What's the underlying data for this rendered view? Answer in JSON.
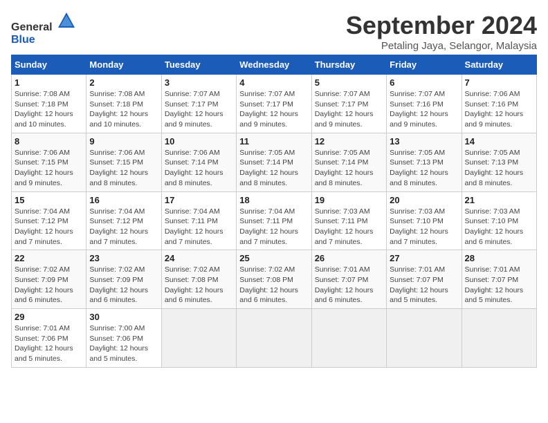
{
  "header": {
    "logo_general": "General",
    "logo_blue": "Blue",
    "month": "September 2024",
    "location": "Petaling Jaya, Selangor, Malaysia"
  },
  "calendar": {
    "weekdays": [
      "Sunday",
      "Monday",
      "Tuesday",
      "Wednesday",
      "Thursday",
      "Friday",
      "Saturday"
    ],
    "weeks": [
      [
        null,
        null,
        {
          "day": "1",
          "sunrise": "Sunrise: 7:08 AM",
          "sunset": "Sunset: 7:18 PM",
          "daylight": "Daylight: 12 hours and 10 minutes."
        },
        {
          "day": "2",
          "sunrise": "Sunrise: 7:08 AM",
          "sunset": "Sunset: 7:18 PM",
          "daylight": "Daylight: 12 hours and 10 minutes."
        },
        {
          "day": "3",
          "sunrise": "Sunrise: 7:07 AM",
          "sunset": "Sunset: 7:17 PM",
          "daylight": "Daylight: 12 hours and 9 minutes."
        },
        {
          "day": "4",
          "sunrise": "Sunrise: 7:07 AM",
          "sunset": "Sunset: 7:17 PM",
          "daylight": "Daylight: 12 hours and 9 minutes."
        },
        {
          "day": "5",
          "sunrise": "Sunrise: 7:07 AM",
          "sunset": "Sunset: 7:17 PM",
          "daylight": "Daylight: 12 hours and 9 minutes."
        },
        {
          "day": "6",
          "sunrise": "Sunrise: 7:07 AM",
          "sunset": "Sunset: 7:16 PM",
          "daylight": "Daylight: 12 hours and 9 minutes."
        },
        {
          "day": "7",
          "sunrise": "Sunrise: 7:06 AM",
          "sunset": "Sunset: 7:16 PM",
          "daylight": "Daylight: 12 hours and 9 minutes."
        }
      ],
      [
        {
          "day": "8",
          "sunrise": "Sunrise: 7:06 AM",
          "sunset": "Sunset: 7:15 PM",
          "daylight": "Daylight: 12 hours and 9 minutes."
        },
        {
          "day": "9",
          "sunrise": "Sunrise: 7:06 AM",
          "sunset": "Sunset: 7:15 PM",
          "daylight": "Daylight: 12 hours and 8 minutes."
        },
        {
          "day": "10",
          "sunrise": "Sunrise: 7:06 AM",
          "sunset": "Sunset: 7:14 PM",
          "daylight": "Daylight: 12 hours and 8 minutes."
        },
        {
          "day": "11",
          "sunrise": "Sunrise: 7:05 AM",
          "sunset": "Sunset: 7:14 PM",
          "daylight": "Daylight: 12 hours and 8 minutes."
        },
        {
          "day": "12",
          "sunrise": "Sunrise: 7:05 AM",
          "sunset": "Sunset: 7:14 PM",
          "daylight": "Daylight: 12 hours and 8 minutes."
        },
        {
          "day": "13",
          "sunrise": "Sunrise: 7:05 AM",
          "sunset": "Sunset: 7:13 PM",
          "daylight": "Daylight: 12 hours and 8 minutes."
        },
        {
          "day": "14",
          "sunrise": "Sunrise: 7:05 AM",
          "sunset": "Sunset: 7:13 PM",
          "daylight": "Daylight: 12 hours and 8 minutes."
        }
      ],
      [
        {
          "day": "15",
          "sunrise": "Sunrise: 7:04 AM",
          "sunset": "Sunset: 7:12 PM",
          "daylight": "Daylight: 12 hours and 7 minutes."
        },
        {
          "day": "16",
          "sunrise": "Sunrise: 7:04 AM",
          "sunset": "Sunset: 7:12 PM",
          "daylight": "Daylight: 12 hours and 7 minutes."
        },
        {
          "day": "17",
          "sunrise": "Sunrise: 7:04 AM",
          "sunset": "Sunset: 7:11 PM",
          "daylight": "Daylight: 12 hours and 7 minutes."
        },
        {
          "day": "18",
          "sunrise": "Sunrise: 7:04 AM",
          "sunset": "Sunset: 7:11 PM",
          "daylight": "Daylight: 12 hours and 7 minutes."
        },
        {
          "day": "19",
          "sunrise": "Sunrise: 7:03 AM",
          "sunset": "Sunset: 7:11 PM",
          "daylight": "Daylight: 12 hours and 7 minutes."
        },
        {
          "day": "20",
          "sunrise": "Sunrise: 7:03 AM",
          "sunset": "Sunset: 7:10 PM",
          "daylight": "Daylight: 12 hours and 7 minutes."
        },
        {
          "day": "21",
          "sunrise": "Sunrise: 7:03 AM",
          "sunset": "Sunset: 7:10 PM",
          "daylight": "Daylight: 12 hours and 6 minutes."
        }
      ],
      [
        {
          "day": "22",
          "sunrise": "Sunrise: 7:02 AM",
          "sunset": "Sunset: 7:09 PM",
          "daylight": "Daylight: 12 hours and 6 minutes."
        },
        {
          "day": "23",
          "sunrise": "Sunrise: 7:02 AM",
          "sunset": "Sunset: 7:09 PM",
          "daylight": "Daylight: 12 hours and 6 minutes."
        },
        {
          "day": "24",
          "sunrise": "Sunrise: 7:02 AM",
          "sunset": "Sunset: 7:08 PM",
          "daylight": "Daylight: 12 hours and 6 minutes."
        },
        {
          "day": "25",
          "sunrise": "Sunrise: 7:02 AM",
          "sunset": "Sunset: 7:08 PM",
          "daylight": "Daylight: 12 hours and 6 minutes."
        },
        {
          "day": "26",
          "sunrise": "Sunrise: 7:01 AM",
          "sunset": "Sunset: 7:07 PM",
          "daylight": "Daylight: 12 hours and 6 minutes."
        },
        {
          "day": "27",
          "sunrise": "Sunrise: 7:01 AM",
          "sunset": "Sunset: 7:07 PM",
          "daylight": "Daylight: 12 hours and 5 minutes."
        },
        {
          "day": "28",
          "sunrise": "Sunrise: 7:01 AM",
          "sunset": "Sunset: 7:07 PM",
          "daylight": "Daylight: 12 hours and 5 minutes."
        }
      ],
      [
        {
          "day": "29",
          "sunrise": "Sunrise: 7:01 AM",
          "sunset": "Sunset: 7:06 PM",
          "daylight": "Daylight: 12 hours and 5 minutes."
        },
        {
          "day": "30",
          "sunrise": "Sunrise: 7:00 AM",
          "sunset": "Sunset: 7:06 PM",
          "daylight": "Daylight: 12 hours and 5 minutes."
        },
        null,
        null,
        null,
        null,
        null
      ]
    ]
  }
}
